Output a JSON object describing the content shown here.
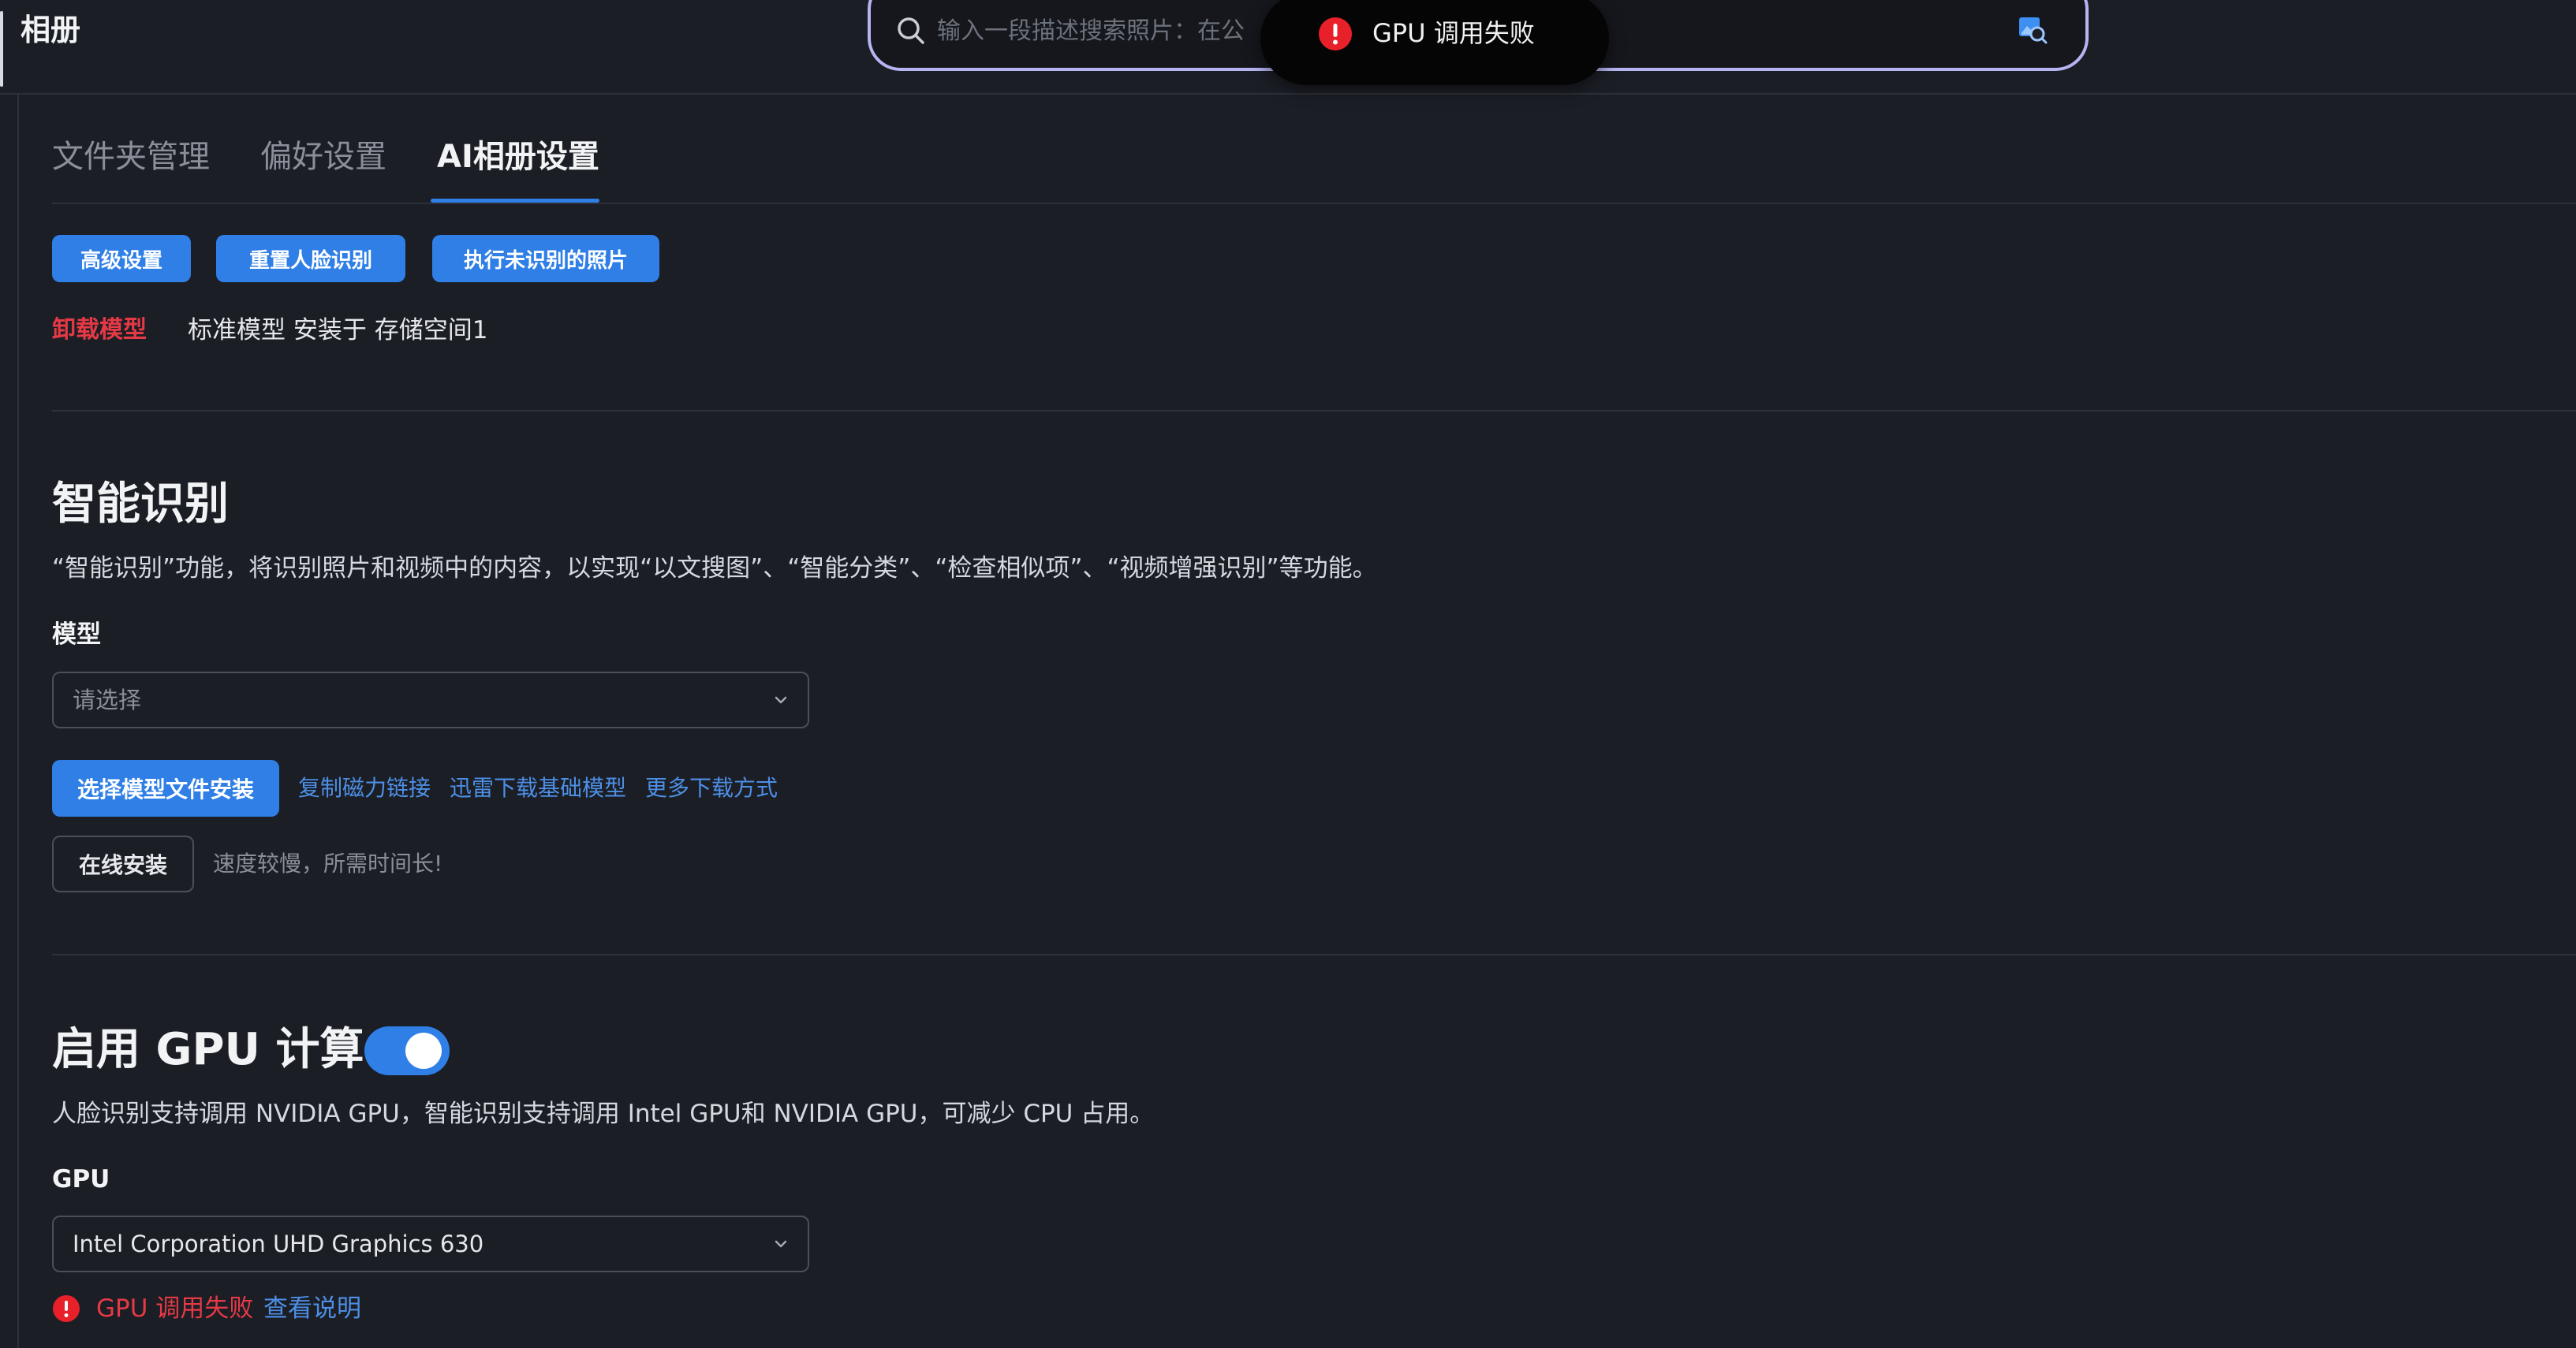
{
  "header": {
    "app_title": "相册",
    "search": {
      "placeholder": "输入一段描述搜索照片：在公",
      "value": ""
    }
  },
  "toast": {
    "message": "GPU 调用失败",
    "icon": "error-icon"
  },
  "tabs": [
    {
      "label": "文件夹管理",
      "active": false
    },
    {
      "label": "偏好设置",
      "active": false
    },
    {
      "label": "AI相册设置",
      "active": true
    }
  ],
  "actions": {
    "advanced": "高级设置",
    "reset_face": "重置人脸识别",
    "run_unrecognized": "执行未识别的照片"
  },
  "model_info": {
    "uninstall_label": "卸载模型",
    "status_text": "标准模型 安装于 存储空间1"
  },
  "smart_recognition": {
    "title": "智能识别",
    "description": "“智能识别”功能，将识别照片和视频中的内容，以实现“以文搜图”、“智能分类”、“检查相似项”、“视频增强识别”等功能。",
    "model_label": "模型",
    "model_select_placeholder": "请选择",
    "select_model_file_btn": "选择模型文件安装",
    "links": {
      "copy_magnet": "复制磁力链接",
      "xunlei": "迅雷下载基础模型",
      "more": "更多下载方式"
    },
    "online_install_btn": "在线安装",
    "online_install_hint": "速度较慢，所需时间长!"
  },
  "gpu": {
    "title": "启用 GPU 计算",
    "enabled": true,
    "description": "人脸识别支持调用 NVIDIA GPU，智能识别支持调用 Intel GPU和 NVIDIA GPU，可减少 CPU 占用。",
    "label": "GPU",
    "selected": "Intel Corporation UHD Graphics 630",
    "error_text": "GPU 调用失败",
    "error_link": "查看说明"
  },
  "colors": {
    "accent": "#2f7fe6",
    "error": "#e63946",
    "link": "#4d8fe6",
    "background": "#1b1e25"
  }
}
